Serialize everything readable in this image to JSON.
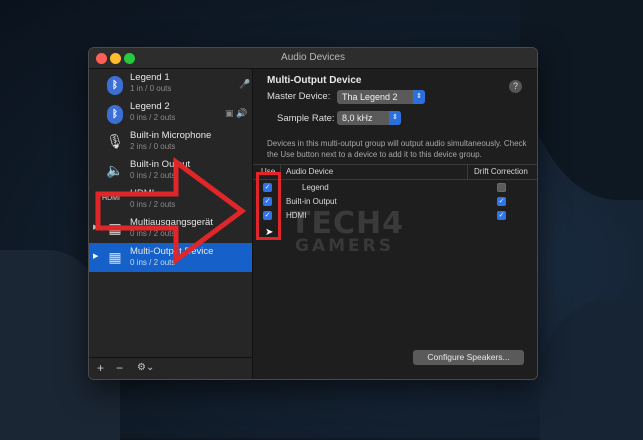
{
  "window": {
    "title": "Audio Devices"
  },
  "sidebar": {
    "devices": [
      {
        "name": "Legend 1",
        "sub": "1 in / 0 outs",
        "icon": "bluetooth-icon",
        "glyph": "ᛒ",
        "side": "🎤"
      },
      {
        "name": "Legend 2",
        "sub": "0 ins / 2 outs",
        "icon": "bluetooth-icon",
        "glyph": "ᛒ",
        "side": "▣ 🔊"
      },
      {
        "name": "Built-in Microphone",
        "sub": "2 ins / 0 outs",
        "icon": "microphone-icon",
        "glyph": "🎙"
      },
      {
        "name": "Built-in Output",
        "sub": "0 ins / 2 outs",
        "icon": "speaker-icon",
        "glyph": "🔈"
      },
      {
        "name": "HDMI",
        "sub": "0 ins / 2 outs",
        "icon": "hdmi-icon",
        "glyph": "HDMI"
      },
      {
        "name": "Multiausgangsgerät",
        "sub": "0 ins / 2 outs",
        "icon": "aggregate-device-icon",
        "glyph": "▦"
      },
      {
        "name": "Multi-Output Device",
        "sub": "0 ins / 2 outs",
        "icon": "multi-output-icon",
        "glyph": "▦",
        "selected": true
      }
    ],
    "footer": {
      "add": "+",
      "remove": "−",
      "gear": "⚙︎⌄"
    }
  },
  "main": {
    "title": "Multi-Output Device",
    "help": "?",
    "master_label": "Master Device:",
    "master_value": "Tha Legend 2",
    "rate_label": "Sample Rate:",
    "rate_value": "8,0 kHz",
    "description": "Devices in this multi-output group will output audio simultaneously. Check the Use button next to a device to add it to this device group.",
    "table": {
      "headers": {
        "use": "Use",
        "device": "Audio Device",
        "drift": "Drift Correction"
      },
      "rows": [
        {
          "name": "Legend",
          "use": true,
          "drift": false
        },
        {
          "name": "Built-in Output",
          "use": true,
          "drift": true
        },
        {
          "name": "HDMI",
          "use": true,
          "drift": true
        }
      ]
    },
    "configure_button": "Configure Speakers..."
  },
  "watermark": {
    "line1": "TECH4",
    "line2": "GAMERS"
  },
  "colors": {
    "accent": "#2f74e8",
    "selection": "#1561c9",
    "annotation_red": "#e1262a"
  }
}
